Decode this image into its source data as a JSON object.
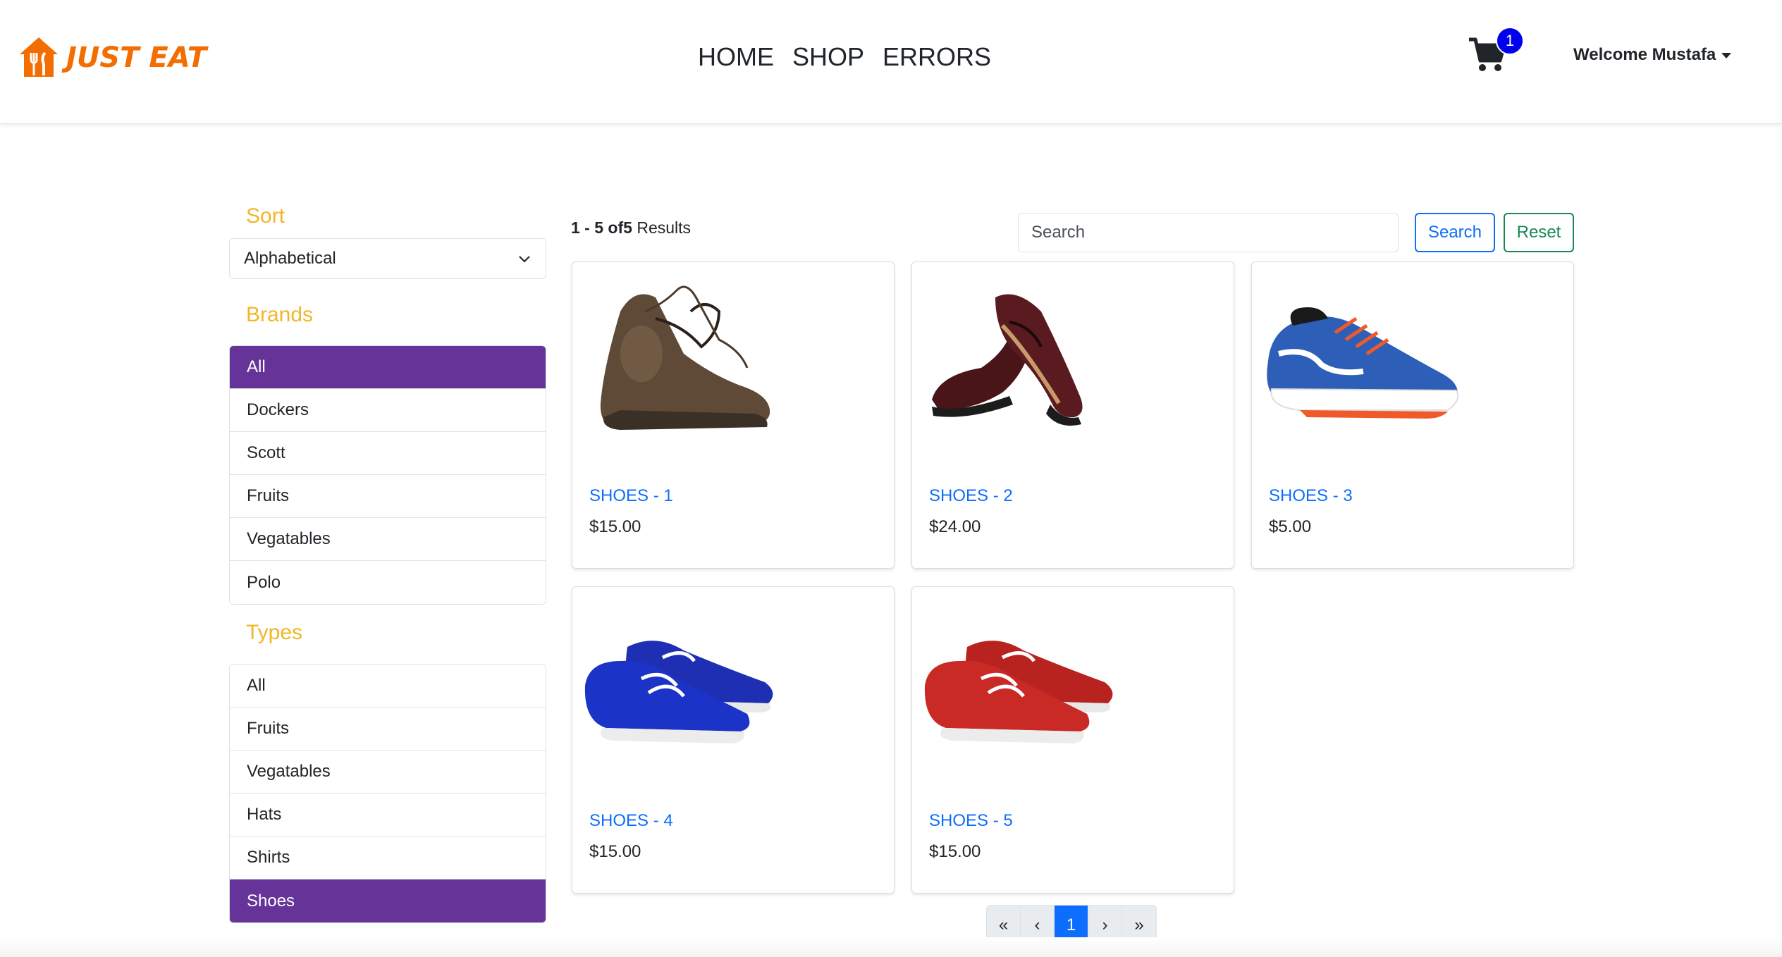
{
  "brand": {
    "name": "JUST EAT",
    "color": "#f36d00"
  },
  "nav": {
    "links": [
      "HOME",
      "SHOP",
      "ERRORS"
    ],
    "cart_count": "1",
    "user_greeting": "Welcome Mustafa"
  },
  "sidebar": {
    "sort_title": "Sort",
    "sort_selected": "Alphabetical",
    "brands_title": "Brands",
    "brands": [
      {
        "label": "All",
        "active": true
      },
      {
        "label": "Dockers",
        "active": false
      },
      {
        "label": "Scott",
        "active": false
      },
      {
        "label": "Fruits",
        "active": false
      },
      {
        "label": "Vegatables",
        "active": false
      },
      {
        "label": "Polo",
        "active": false
      }
    ],
    "types_title": "Types",
    "types": [
      {
        "label": "All",
        "active": false
      },
      {
        "label": "Fruits",
        "active": false
      },
      {
        "label": "Vegatables",
        "active": false
      },
      {
        "label": "Hats",
        "active": false
      },
      {
        "label": "Shirts",
        "active": false
      },
      {
        "label": "Shoes",
        "active": true
      }
    ],
    "accent_color": "#663399",
    "title_color": "#f2b627"
  },
  "results": {
    "range": "1 - 5",
    "of_label": "of",
    "total": "5",
    "suffix": "Results"
  },
  "search": {
    "placeholder": "Search",
    "search_label": "Search",
    "reset_label": "Reset"
  },
  "products": [
    {
      "name": "SHOES - 1",
      "price": "$15.00",
      "image": "brown-hiking-shoes"
    },
    {
      "name": "SHOES - 2",
      "price": "$24.00",
      "image": "burgundy-derby-shoes"
    },
    {
      "name": "SHOES - 3",
      "price": "$5.00",
      "image": "blue-running-shoes"
    },
    {
      "name": "SHOES - 4",
      "price": "$15.00",
      "image": "blue-boat-shoes"
    },
    {
      "name": "SHOES - 5",
      "price": "$15.00",
      "image": "red-boat-shoes"
    }
  ],
  "pagination": {
    "first": "«",
    "prev": "‹",
    "current": "1",
    "next": "›",
    "last": "»"
  }
}
